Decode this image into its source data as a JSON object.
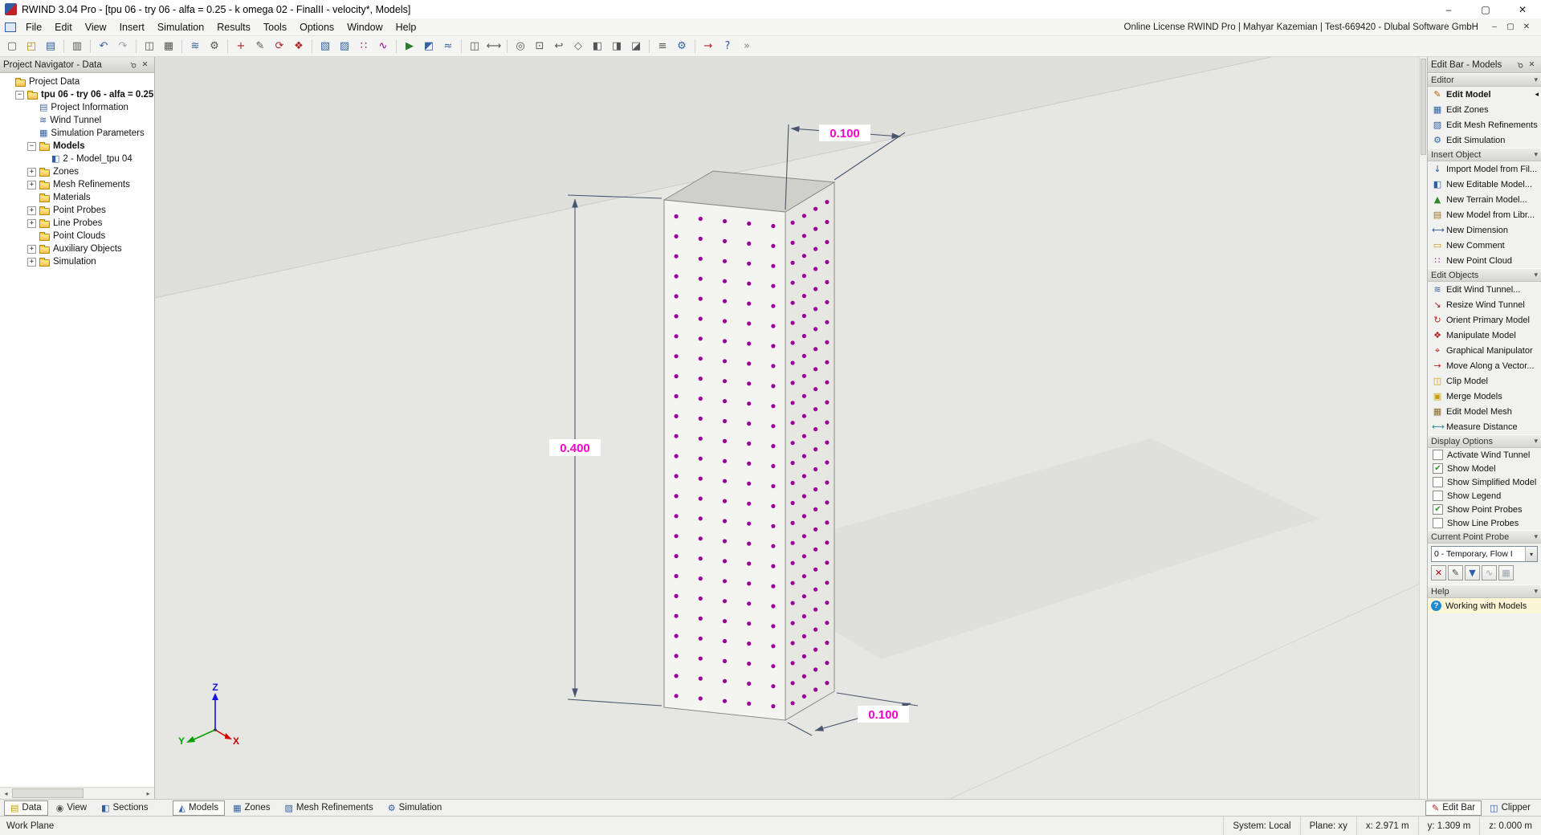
{
  "titlebar": {
    "title": "RWIND 3.04 Pro - [tpu 06 - try 06 - alfa = 0.25 - k omega 02 - FinalII -  velocity*, Models]",
    "window_buttons": {
      "minimize": "–",
      "maximize": "▢",
      "close": "✕"
    }
  },
  "menubar": {
    "items": [
      "File",
      "Edit",
      "View",
      "Insert",
      "Simulation",
      "Results",
      "Tools",
      "Options",
      "Window",
      "Help"
    ],
    "license": "Online License RWIND Pro | Mahyar Kazemian | Test-669420 - Dlubal Software GmbH",
    "mdi_buttons": {
      "minimize": "–",
      "restore": "▢",
      "close": "✕"
    }
  },
  "toolbar": {
    "icons": [
      {
        "name": "new-project",
        "glyph": "▢",
        "color": "#555555"
      },
      {
        "name": "open-project",
        "glyph": "◰",
        "color": "#b8860b"
      },
      {
        "name": "save-project",
        "glyph": "▤",
        "color": "#2f5fa5"
      },
      {
        "sep": true
      },
      {
        "name": "print",
        "glyph": "▥",
        "color": "#555555"
      },
      {
        "sep": true
      },
      {
        "name": "undo",
        "glyph": "↶",
        "color": "#2f5fa5"
      },
      {
        "name": "redo",
        "glyph": "↷",
        "color": "#9aa4ae"
      },
      {
        "sep": true
      },
      {
        "name": "project-navigator",
        "glyph": "◫",
        "color": "#555555"
      },
      {
        "name": "tables",
        "glyph": "▦",
        "color": "#555555"
      },
      {
        "sep": true
      },
      {
        "name": "wind-tunnel",
        "glyph": "≋",
        "color": "#2f5fa5"
      },
      {
        "name": "simulation-parameters",
        "glyph": "⚙",
        "color": "#555555"
      },
      {
        "sep": true
      },
      {
        "name": "new-model",
        "glyph": "+",
        "color": "#b22222"
      },
      {
        "name": "edit-model",
        "glyph": "✎",
        "color": "#555555"
      },
      {
        "name": "orient-model",
        "glyph": "⟳",
        "color": "#b22222"
      },
      {
        "name": "manipulate-model",
        "glyph": "❖",
        "color": "#b22222"
      },
      {
        "sep": true
      },
      {
        "name": "new-zone",
        "glyph": "▧",
        "color": "#2f5fa5"
      },
      {
        "name": "new-mesh-refinement",
        "glyph": "▨",
        "color": "#2f5fa5"
      },
      {
        "name": "new-point-probe",
        "glyph": "∷",
        "color": "#9a009a"
      },
      {
        "name": "new-line-probe",
        "glyph": "∿",
        "color": "#9a009a"
      },
      {
        "sep": true
      },
      {
        "name": "start-simulation",
        "glyph": "▶",
        "color": "#2a7a2a"
      },
      {
        "name": "show-results",
        "glyph": "◩",
        "color": "#2f5fa5"
      },
      {
        "name": "animate-flow",
        "glyph": "≈",
        "color": "#2f5fa5"
      },
      {
        "sep": true
      },
      {
        "name": "clipping-planes",
        "glyph": "◫",
        "color": "#555555"
      },
      {
        "name": "measure",
        "glyph": "⟷",
        "color": "#555555"
      },
      {
        "sep": true
      },
      {
        "name": "zoom-extents",
        "glyph": "◎",
        "color": "#555555"
      },
      {
        "name": "zoom-window",
        "glyph": "⊡",
        "color": "#555555"
      },
      {
        "name": "previous-view",
        "glyph": "↩",
        "color": "#555555"
      },
      {
        "name": "isometric-view",
        "glyph": "◇",
        "color": "#555555"
      },
      {
        "name": "view-x",
        "glyph": "◧",
        "color": "#555555"
      },
      {
        "name": "view-y",
        "glyph": "◨",
        "color": "#555555"
      },
      {
        "name": "view-z",
        "glyph": "◪",
        "color": "#555555"
      },
      {
        "sep": true
      },
      {
        "name": "display-properties",
        "glyph": "≡",
        "color": "#555555"
      },
      {
        "name": "options",
        "glyph": "⚙",
        "color": "#2f5fa5"
      },
      {
        "sep": true
      },
      {
        "name": "move-along-vector",
        "glyph": "→",
        "color": "#b22222"
      },
      {
        "name": "help",
        "glyph": "?",
        "color": "#2f5fa5"
      },
      {
        "name": "toolbar-overflow",
        "glyph": "»",
        "color": "#888888"
      }
    ]
  },
  "navigator": {
    "title": "Project Navigator - Data",
    "tree": [
      {
        "indent": 0,
        "exp": "",
        "icon": "folder",
        "label": "Project Data",
        "bold": false
      },
      {
        "indent": 1,
        "exp": "minus",
        "icon": "folder",
        "label": "tpu 06 - try 06 - alfa = 0.25",
        "bold": true
      },
      {
        "indent": 2,
        "exp": "",
        "icon": "doc",
        "label": "Project Information",
        "bold": false
      },
      {
        "indent": 2,
        "exp": "",
        "icon": "wind",
        "label": "Wind Tunnel",
        "bold": false
      },
      {
        "indent": 2,
        "exp": "",
        "icon": "table",
        "label": "Simulation Parameters",
        "bold": false
      },
      {
        "indent": 2,
        "exp": "minus",
        "icon": "folder",
        "label": "Models",
        "bold": true
      },
      {
        "indent": 3,
        "exp": "",
        "icon": "model",
        "label": "2 - Model_tpu 04",
        "bold": false
      },
      {
        "indent": 2,
        "exp": "plus",
        "icon": "folder",
        "label": "Zones",
        "bold": false
      },
      {
        "indent": 2,
        "exp": "plus",
        "icon": "folder",
        "label": "Mesh Refinements",
        "bold": false
      },
      {
        "indent": 2,
        "exp": "",
        "icon": "folder",
        "label": "Materials",
        "bold": false
      },
      {
        "indent": 2,
        "exp": "plus",
        "icon": "folder",
        "label": "Point Probes",
        "bold": false
      },
      {
        "indent": 2,
        "exp": "plus",
        "icon": "folder",
        "label": "Line Probes",
        "bold": false
      },
      {
        "indent": 2,
        "exp": "",
        "icon": "folder",
        "label": "Point Clouds",
        "bold": false
      },
      {
        "indent": 2,
        "exp": "plus",
        "icon": "folder",
        "label": "Auxiliary Objects",
        "bold": false
      },
      {
        "indent": 2,
        "exp": "plus",
        "icon": "folder",
        "label": "Simulation",
        "bold": false
      }
    ]
  },
  "viewport": {
    "dimensions": {
      "top_width": "0.100",
      "height": "0.400",
      "bottom_depth": "0.100"
    },
    "axes": {
      "x": "X",
      "y": "Y",
      "z": "Z"
    },
    "probe_grid": {
      "front_columns": 5,
      "side_columns": 4,
      "rows": 25
    },
    "colors": {
      "dimension_text": "#f402c8",
      "probe_dot": "#9a009a"
    }
  },
  "editbar": {
    "title": "Edit Bar - Models",
    "sections": [
      {
        "header": "Editor",
        "items": [
          {
            "label": "Edit Model",
            "icon": "edit-model",
            "bold": true,
            "current": true
          },
          {
            "label": "Edit Zones",
            "icon": "edit-zones"
          },
          {
            "label": "Edit Mesh Refinements",
            "icon": "edit-mesh-refinements"
          },
          {
            "label": "Edit Simulation",
            "icon": "edit-simulation"
          }
        ]
      },
      {
        "header": "Insert Object",
        "items": [
          {
            "label": "Import Model from Fil...",
            "icon": "import-model-from-file"
          },
          {
            "label": "New Editable Model...",
            "icon": "new-editable-model"
          },
          {
            "label": "New Terrain Model...",
            "icon": "new-terrain-model"
          },
          {
            "label": "New Model from Libr...",
            "icon": "new-model-from-library"
          },
          {
            "label": "New Dimension",
            "icon": "new-dimension"
          },
          {
            "label": "New Comment",
            "icon": "new-comment"
          },
          {
            "label": "New Point Cloud",
            "icon": "new-point-cloud"
          }
        ]
      },
      {
        "header": "Edit Objects",
        "items": [
          {
            "label": "Edit Wind Tunnel...",
            "icon": "edit-wind-tunnel"
          },
          {
            "label": "Resize Wind Tunnel",
            "icon": "resize-wind-tunnel"
          },
          {
            "label": "Orient Primary Model",
            "icon": "orient-primary-model"
          },
          {
            "label": "Manipulate Model",
            "icon": "manipulate-model"
          },
          {
            "label": "Graphical Manipulator",
            "icon": "graphical-manipulator"
          },
          {
            "label": "Move Along a Vector...",
            "icon": "move-along-a-vector"
          },
          {
            "label": "Clip Model",
            "icon": "clip-model"
          },
          {
            "label": "Merge Models",
            "icon": "merge-models"
          },
          {
            "label": "Edit Model Mesh",
            "icon": "edit-model-mesh"
          },
          {
            "label": "Measure Distance",
            "icon": "measure-distance"
          }
        ]
      },
      {
        "header": "Display Options",
        "checkboxes": [
          {
            "label": "Activate Wind Tunnel",
            "checked": false
          },
          {
            "label": "Show Model",
            "checked": true
          },
          {
            "label": "Show Simplified Model",
            "checked": false
          },
          {
            "label": "Show Legend",
            "checked": false
          },
          {
            "label": "Show Point Probes",
            "checked": true
          },
          {
            "label": "Show Line Probes",
            "checked": false
          }
        ]
      },
      {
        "header": "Current Point Probe",
        "probe": {
          "selected": "0 - Temporary, Flow I",
          "buttons": [
            {
              "name": "delete-point-probe-button",
              "glyph": "✕",
              "color": "#c00000"
            },
            {
              "name": "edit-point-probe-button",
              "glyph": "✎",
              "color": "#444444"
            },
            {
              "name": "save-point-probe-button",
              "glyph": "▼",
              "color": "#2f5fa5"
            },
            {
              "name": "probe-diagram-button",
              "glyph": "∿",
              "color": "#9aa4ae"
            },
            {
              "name": "probe-table-button",
              "glyph": "▦",
              "color": "#9aa4ae"
            }
          ]
        }
      },
      {
        "header": "Help",
        "help": {
          "label": "Working with Models"
        }
      }
    ]
  },
  "tabs": {
    "left": [
      {
        "label": "Data",
        "icon": "data",
        "glyph": "▤",
        "color": "#c8a000",
        "active": true
      },
      {
        "label": "View",
        "icon": "view",
        "glyph": "◉",
        "color": "#555555",
        "active": false
      },
      {
        "label": "Sections",
        "icon": "sections",
        "glyph": "◧",
        "color": "#2f5fa5",
        "active": false
      }
    ],
    "center": [
      {
        "label": "Models",
        "icon": "models",
        "glyph": "◭",
        "color": "#2f5fa5",
        "active": true
      },
      {
        "label": "Zones",
        "icon": "zones",
        "glyph": "▦",
        "color": "#2f5fa5",
        "active": false
      },
      {
        "label": "Mesh Refinements",
        "icon": "mesh-refinements",
        "glyph": "▨",
        "color": "#2f5fa5",
        "active": false
      },
      {
        "label": "Simulation",
        "icon": "simulation",
        "glyph": "⚙",
        "color": "#2f5fa5",
        "active": false
      }
    ],
    "right": [
      {
        "label": "Edit Bar",
        "icon": "edit-bar",
        "glyph": "✎",
        "color": "#b22222",
        "active": true
      },
      {
        "label": "Clipper",
        "icon": "clipper",
        "glyph": "◫",
        "color": "#2f5fa5",
        "active": false
      }
    ]
  },
  "statusbar": {
    "mode": "Work Plane",
    "segments": [
      "System: Local",
      "Plane: xy",
      "x:  2.971 m",
      "y:  1.309 m",
      "z:  0.000 m"
    ]
  }
}
